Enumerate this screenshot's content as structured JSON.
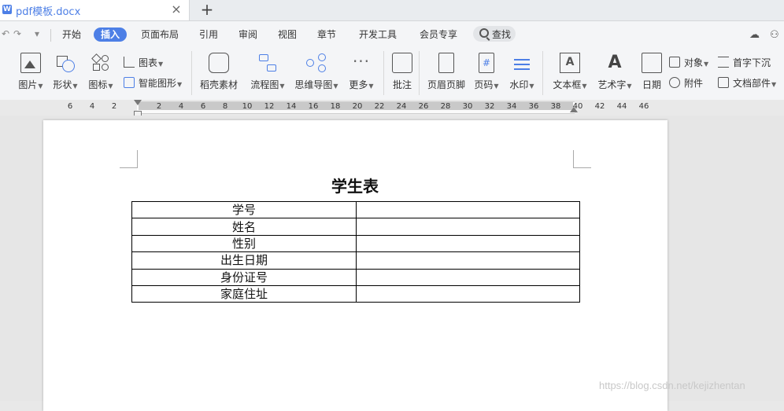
{
  "tab": {
    "icon_letter": "W",
    "title": "pdf模板.docx",
    "close": "×",
    "new": "+"
  },
  "quick_access": {
    "undo": "↶",
    "redo": "↷",
    "dropdown": "▾"
  },
  "menu": {
    "items": [
      "开始",
      "插入",
      "页面布局",
      "引用",
      "审阅",
      "视图",
      "章节",
      "开发工具",
      "会员专享"
    ],
    "active_index": 1,
    "search_label": "查找"
  },
  "ribbon": {
    "picture": "图片",
    "shape": "形状",
    "icon": "图标",
    "chart": "图表",
    "smart_art": "智能图形",
    "docer_material": "稻壳素材",
    "flowchart": "流程图",
    "mindmap": "思维导图",
    "more": "更多",
    "comment": "批注",
    "header_footer": "页眉页脚",
    "page_number": "页码",
    "watermark": "水印",
    "textbox": "文本框",
    "wordart": "艺术字",
    "date": "日期",
    "object": "对象",
    "attachment": "附件",
    "drop_cap": "首字下沉",
    "doc_parts": "文档部件",
    "more_glyph": "···",
    "textbox_glyph": "A",
    "wordart_glyph": "A",
    "page_number_glyph": "#"
  },
  "ruler": {
    "ticks": [
      "6",
      "4",
      "2",
      "2",
      "4",
      "6",
      "8",
      "10",
      "12",
      "14",
      "16",
      "18",
      "20",
      "22",
      "24",
      "26",
      "28",
      "30",
      "32",
      "34",
      "36",
      "38",
      "40",
      "42",
      "44",
      "46"
    ]
  },
  "document": {
    "title": "学生表",
    "rows": [
      {
        "label": "学号",
        "value": ""
      },
      {
        "label": "姓名",
        "value": ""
      },
      {
        "label": "性别",
        "value": ""
      },
      {
        "label": "出生日期",
        "value": ""
      },
      {
        "label": "身份证号",
        "value": ""
      },
      {
        "label": "家庭住址",
        "value": ""
      }
    ]
  },
  "watermark_text": "https://blog.csdn.net/kejizhentan",
  "colors": {
    "accent": "#4d7fe6"
  }
}
